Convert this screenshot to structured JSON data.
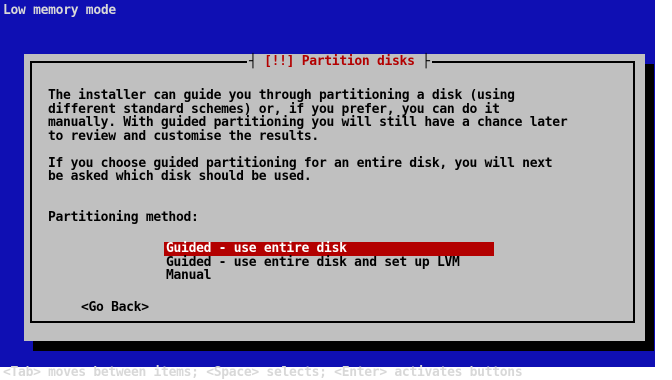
{
  "status_bar": {
    "title": "Low memory mode"
  },
  "dialog": {
    "title": "[!!] Partition disks",
    "paragraphs": [
      "The installer can guide you through partitioning a disk (using\ndifferent standard schemes) or, if you prefer, you can do it\nmanually. With guided partitioning you will still have a chance later\nto review and customise the results.",
      "If you choose guided partitioning for an entire disk, you will next\nbe asked which disk should be used."
    ],
    "method_label": "Partitioning method:",
    "options": [
      {
        "label": "Guided - use entire disk",
        "selected": true
      },
      {
        "label": "Guided - use entire disk and set up LVM",
        "selected": false
      },
      {
        "label": "Manual",
        "selected": false
      }
    ],
    "go_back_label": "<Go Back>"
  },
  "footer": {
    "hint": "<Tab> moves between items; <Space> selects; <Enter> activates buttons"
  },
  "colors": {
    "screen_background": "#0f0fb3",
    "dialog_background": "#c0c0c0",
    "accent": "#b30000"
  }
}
